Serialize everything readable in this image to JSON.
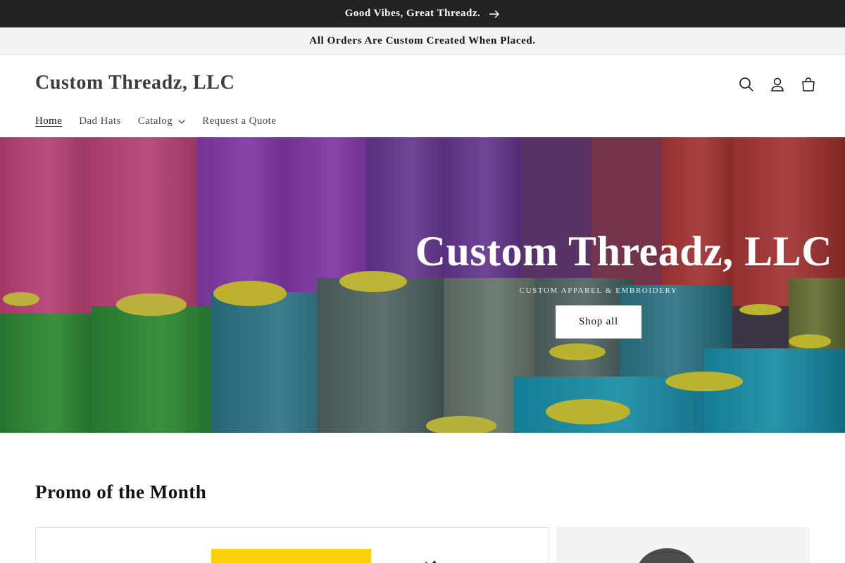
{
  "announcement": {
    "text": "Good Vibes, Great Threadz."
  },
  "announcement2": {
    "text": "All Orders Are Custom Created When Placed."
  },
  "header": {
    "logo": "Custom Threadz, LLC",
    "icons": [
      "search-icon",
      "account-icon",
      "cart-icon"
    ]
  },
  "nav": {
    "items": [
      {
        "label": "Home"
      },
      {
        "label": "Dad Hats"
      },
      {
        "label": "Catalog"
      },
      {
        "label": "Request a Quote"
      }
    ]
  },
  "hero": {
    "title": "Custom Threadz, LLC",
    "subtitle": "CUSTOM APPAREL & EMBROIDERY",
    "button": "Shop all"
  },
  "promo": {
    "title": "Promo of the Month"
  },
  "colors": {
    "announcement_bg": "#222222",
    "subbar_bg": "#f3f3f3",
    "button_bg": "#ffffff",
    "promo_yellow": "#fdd10a"
  }
}
